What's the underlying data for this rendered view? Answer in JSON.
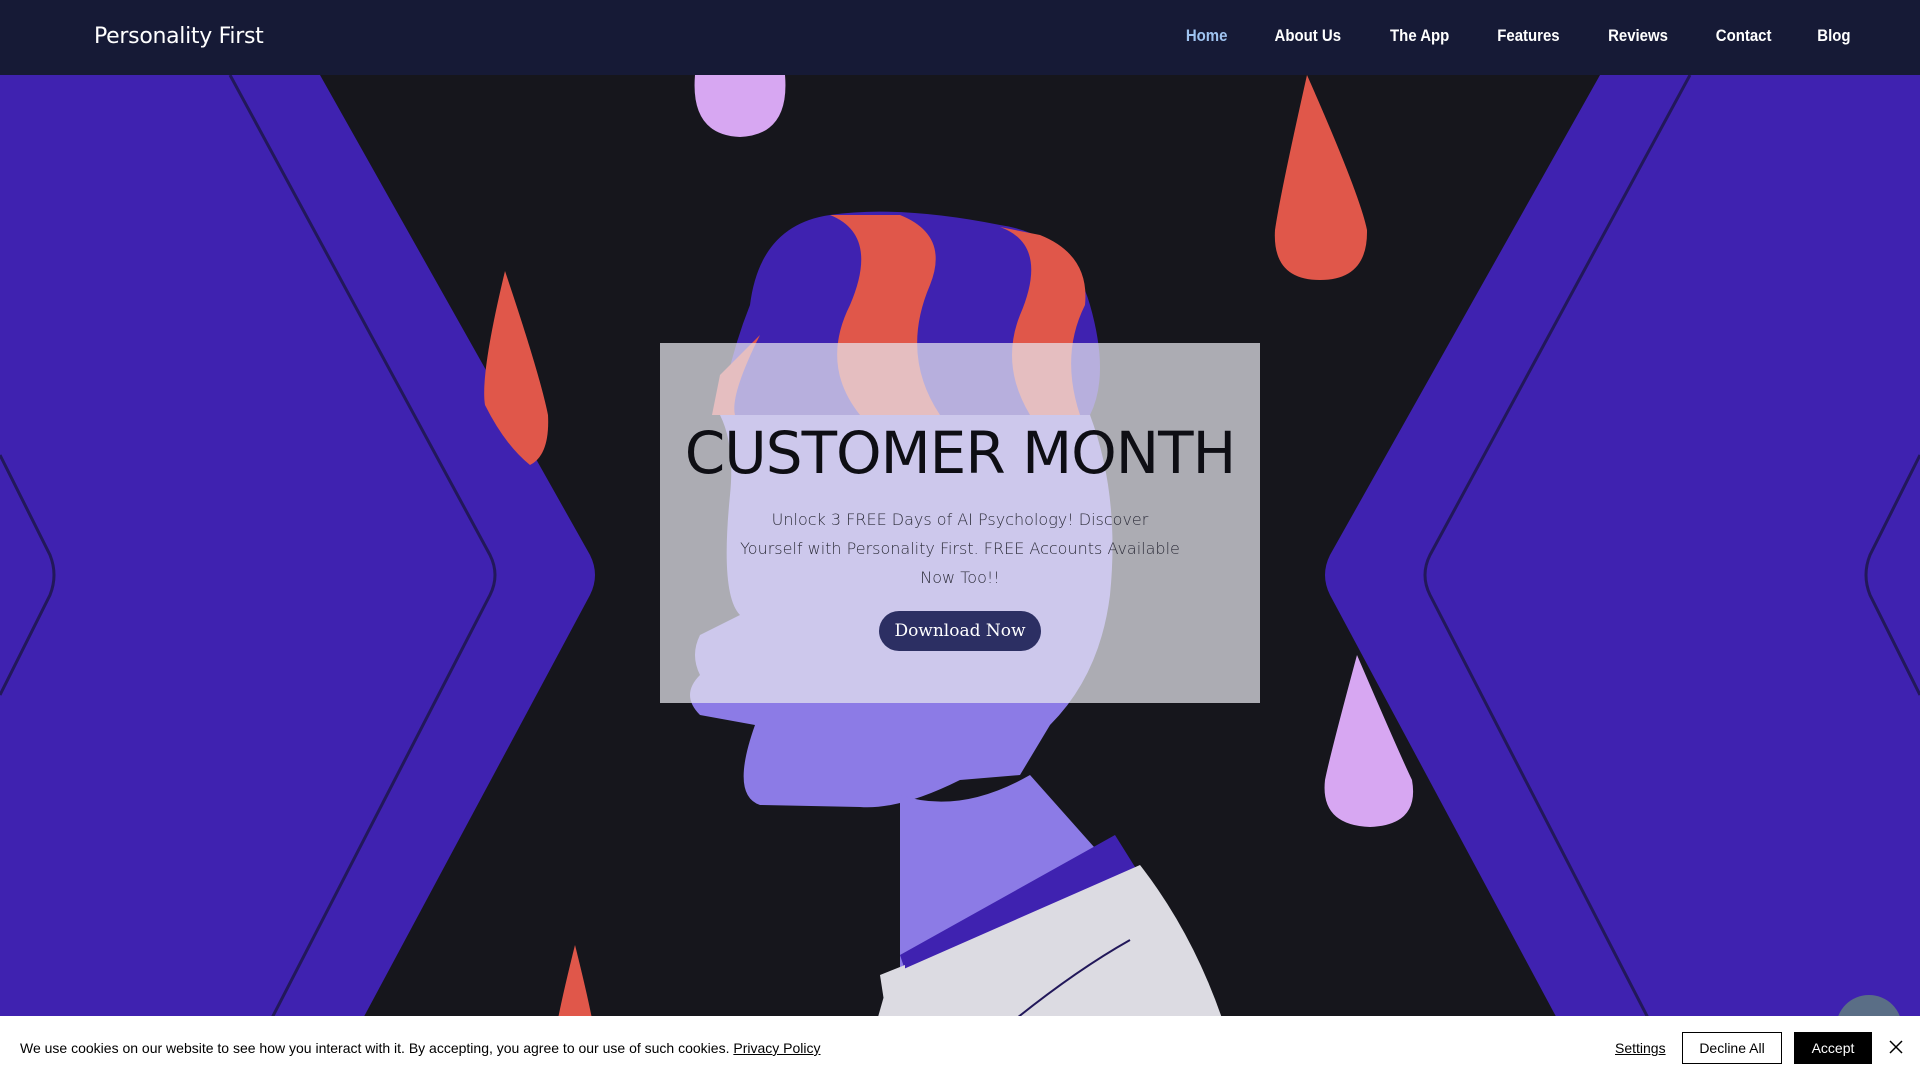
{
  "header": {
    "brand": "Personality First",
    "nav": [
      {
        "label": "Home",
        "active": true
      },
      {
        "label": "About Us",
        "active": false
      },
      {
        "label": "The App",
        "active": false
      },
      {
        "label": "Features",
        "active": false
      },
      {
        "label": "Reviews",
        "active": false
      },
      {
        "label": "Contact",
        "active": false
      },
      {
        "label": "Blog",
        "active": false
      }
    ]
  },
  "hero": {
    "title": "CUSTOMER MONTH",
    "text": "Unlock 3 FREE Days of AI Psychology! Discover Yourself with Personality First. FREE Accounts Available Now Too!!",
    "cta_label": "Download Now"
  },
  "cookie_bar": {
    "text": "We use cookies on our website to see how you interact with it. By accepting, you agree to our use of such cookies.",
    "privacy_link": "Privacy Policy",
    "settings_label": "Settings",
    "decline_label": "Decline All",
    "accept_label": "Accept"
  },
  "colors": {
    "header_bg": "#161a36",
    "nav_active": "#9fc3f0",
    "hero_purple": "#3f22b0",
    "accent_red": "#e0574a",
    "lilac": "#d7a7f2",
    "cta_bg": "#2c2f63"
  },
  "icons": {
    "close": "close-icon",
    "chat": "chat-icon"
  }
}
